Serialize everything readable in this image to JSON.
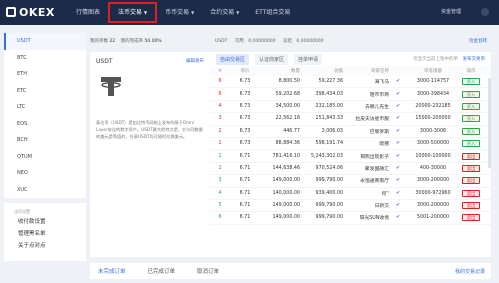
{
  "header": {
    "logo": "OKEX",
    "nav": [
      {
        "label": "行情图表",
        "active": false,
        "caret": false
      },
      {
        "label": "法币交易",
        "active": true,
        "caret": true
      },
      {
        "label": "币币交易",
        "active": false,
        "caret": true
      },
      {
        "label": "合约交易",
        "active": false,
        "caret": true
      },
      {
        "label": "ETT组合交易",
        "active": false,
        "caret": false
      }
    ],
    "account": "资金管理"
  },
  "sidebar": {
    "coins": [
      "USDT",
      "BTC",
      "ETH",
      "ETC",
      "LTC",
      "EOS",
      "BCH",
      "QTUM",
      "NEO",
      "XUC"
    ],
    "section_title": "法币设置",
    "menu": [
      "收付款设置",
      "管理黑名单",
      "关于点对点"
    ]
  },
  "stats": {
    "orders_label": "我的单数",
    "orders": "22",
    "rate_label": "我的完成率",
    "rate": "50.00%"
  },
  "balance": {
    "coin": "USDT",
    "available_label": "可用",
    "available": "0.00000000",
    "frozen_label": "冻结",
    "frozen": "0.00000000",
    "link": "资金划转"
  },
  "info": {
    "title": "USDT",
    "edit": "编辑发布",
    "desc": "泰达币（USDT）是由比特币网络上发布的基于Omni Layer协议的数字资产。USDT最大的特点是，它与同数量的美元是等值的，任意USDT均可随时兑换美元。"
  },
  "orders": {
    "tabs": [
      "自由交易区",
      "认证商家区",
      "挂单申请"
    ],
    "right_text": "仅显示当前上架中的单",
    "right_link": "发布交易单",
    "columns": [
      "#",
      "单价",
      "数量",
      "总额",
      "商家名称",
      "",
      "单笔限额",
      "操作"
    ],
    "rows": [
      {
        "idx": "6",
        "color": "red",
        "price": "6.73",
        "qty": "8,800.50",
        "total": "59,227.36",
        "name": "海飞马",
        "limit": "3000-114757",
        "action": "买入",
        "type": "buy"
      },
      {
        "idx": "6",
        "color": "red",
        "price": "6.73",
        "qty": "59,202.68",
        "total": "398,434.03",
        "name": "陌币币商",
        "limit": "3000-398434",
        "action": "买入",
        "type": "buy"
      },
      {
        "idx": "4",
        "color": "red",
        "price": "6.73",
        "qty": "34,500.00",
        "total": "232,185.00",
        "name": "去哪儿先生",
        "limit": "20000-232185",
        "action": "买入",
        "type": "buy"
      },
      {
        "idx": "3",
        "color": "red",
        "price": "6.73",
        "qty": "22,562.16",
        "total": "151,843.33",
        "name": "拉皮夫访星币服",
        "limit": "15000-200000",
        "action": "买入",
        "type": "buy"
      },
      {
        "idx": "2",
        "color": "red",
        "price": "6.73",
        "qty": "446.77",
        "total": "3,006.03",
        "name": "巴黎罗斯",
        "limit": "3000-3006",
        "action": "买入",
        "type": "buy"
      },
      {
        "idx": "1",
        "color": "red",
        "price": "6.73",
        "qty": "88,884.36",
        "total": "598,191.74",
        "name": "嗯猪",
        "limit": "3000-500000",
        "action": "买入",
        "type": "buy"
      },
      {
        "idx": "1",
        "color": "green",
        "price": "6.71",
        "qty": "781,416.10",
        "total": "5,243,302.03",
        "name": "褐熊出现影子",
        "limit": "10000-100000",
        "action": "卖出",
        "type": "sell"
      },
      {
        "idx": "2",
        "color": "green",
        "price": "6.71",
        "qty": "144,638.46",
        "total": "970,524.06",
        "name": "聚发国融汇",
        "limit": "400-30000",
        "action": "卖出",
        "type": "sell"
      },
      {
        "idx": "3",
        "color": "green",
        "price": "6.71",
        "qty": "149,000.00",
        "total": "999,790.00",
        "name": "永恒通商南厅",
        "limit": "3000-200000",
        "action": "卖出",
        "type": "sell"
      },
      {
        "idx": "4",
        "color": "green",
        "price": "6.71",
        "qty": "140,000.00",
        "total": "939,400.00",
        "name": "何''",
        "limit": "30000-972960",
        "action": "卖出",
        "type": "sell"
      },
      {
        "idx": "5",
        "color": "green",
        "price": "6.71",
        "qty": "149,000.00",
        "total": "999,790.00",
        "name": "日新交",
        "limit": "3000-200000",
        "action": "卖出",
        "type": "sell"
      },
      {
        "idx": "6",
        "color": "green",
        "price": "6.71",
        "qty": "149,000.00",
        "total": "999,790.00",
        "name": "阳光SUN收债",
        "limit": "5001-200000",
        "action": "卖出",
        "type": "sell"
      }
    ]
  },
  "bottom": {
    "tabs": [
      "未完成订单",
      "已完成订单",
      "取消订单"
    ],
    "history": "我的交易记录"
  }
}
